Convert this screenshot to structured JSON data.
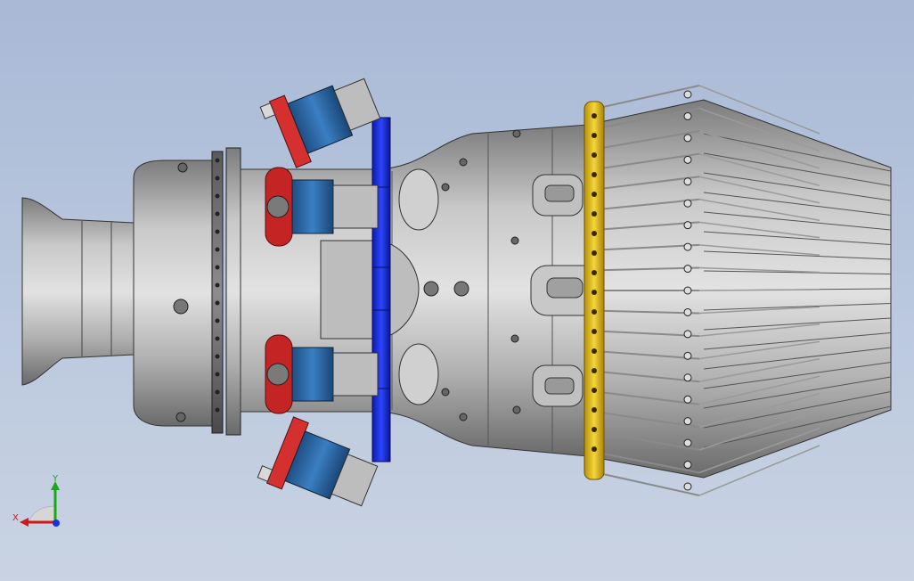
{
  "app": {
    "view": "3d-model-viewport"
  },
  "axis_triad": {
    "x_label": "X",
    "y_label": "Y",
    "x_color": "#d01818",
    "y_color": "#18a818",
    "z_color": "#1830e0"
  },
  "colors": {
    "background_top": "#a9b9d6",
    "background_bottom": "#c9d3e3",
    "body_metal": "#b9b9b9",
    "flange_red": "#c52424",
    "valve_blue": "#2f6aa6",
    "band_blue": "#1e2fe0",
    "ring_gold": "#e5c21c"
  }
}
